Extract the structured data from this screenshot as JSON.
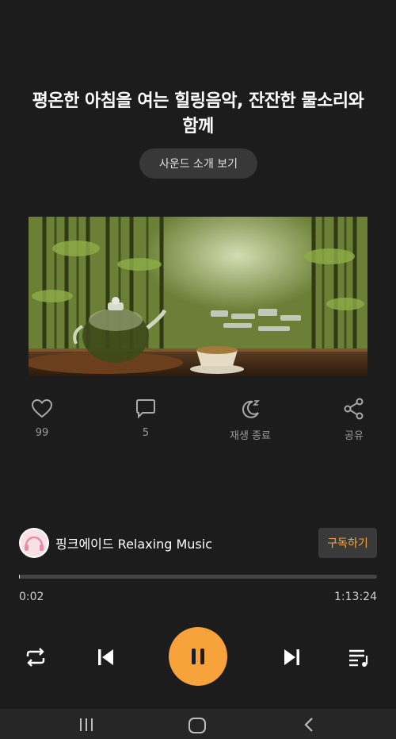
{
  "video": {
    "title": "평온한 아침을 여는 힐링음악, 잔잔한 물소리와 함께",
    "sound_intro_label": "사운드 소개 보기"
  },
  "actions": {
    "like": {
      "icon": "heart-icon",
      "label": "99"
    },
    "comment": {
      "icon": "comment-icon",
      "label": "5"
    },
    "sleep": {
      "icon": "sleep-timer-icon",
      "label": "재생 종료"
    },
    "share": {
      "icon": "share-icon",
      "label": "공유"
    }
  },
  "channel": {
    "name": "핑크에이드 Relaxing Music",
    "subscribe_label": "구독하기",
    "avatar_icon": "headphones-icon"
  },
  "player": {
    "current_time": "0:02",
    "total_time": "1:13:24",
    "progress": 0.0005,
    "state": "playing"
  },
  "colors": {
    "accent": "#f7a23a",
    "background": "#1c1c1c",
    "subscribe_text": "#f5a93a"
  }
}
